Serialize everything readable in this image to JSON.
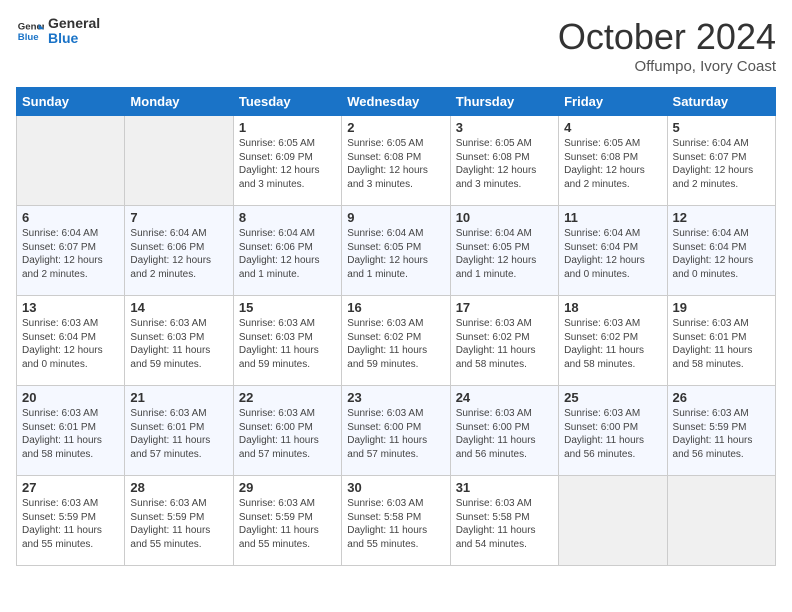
{
  "header": {
    "logo_line1": "General",
    "logo_line2": "Blue",
    "month": "October 2024",
    "location": "Offumpo, Ivory Coast"
  },
  "weekdays": [
    "Sunday",
    "Monday",
    "Tuesday",
    "Wednesday",
    "Thursday",
    "Friday",
    "Saturday"
  ],
  "weeks": [
    [
      {
        "day": "",
        "info": ""
      },
      {
        "day": "",
        "info": ""
      },
      {
        "day": "1",
        "info": "Sunrise: 6:05 AM\nSunset: 6:09 PM\nDaylight: 12 hours and 3 minutes."
      },
      {
        "day": "2",
        "info": "Sunrise: 6:05 AM\nSunset: 6:08 PM\nDaylight: 12 hours and 3 minutes."
      },
      {
        "day": "3",
        "info": "Sunrise: 6:05 AM\nSunset: 6:08 PM\nDaylight: 12 hours and 3 minutes."
      },
      {
        "day": "4",
        "info": "Sunrise: 6:05 AM\nSunset: 6:08 PM\nDaylight: 12 hours and 2 minutes."
      },
      {
        "day": "5",
        "info": "Sunrise: 6:04 AM\nSunset: 6:07 PM\nDaylight: 12 hours and 2 minutes."
      }
    ],
    [
      {
        "day": "6",
        "info": "Sunrise: 6:04 AM\nSunset: 6:07 PM\nDaylight: 12 hours and 2 minutes."
      },
      {
        "day": "7",
        "info": "Sunrise: 6:04 AM\nSunset: 6:06 PM\nDaylight: 12 hours and 2 minutes."
      },
      {
        "day": "8",
        "info": "Sunrise: 6:04 AM\nSunset: 6:06 PM\nDaylight: 12 hours and 1 minute."
      },
      {
        "day": "9",
        "info": "Sunrise: 6:04 AM\nSunset: 6:05 PM\nDaylight: 12 hours and 1 minute."
      },
      {
        "day": "10",
        "info": "Sunrise: 6:04 AM\nSunset: 6:05 PM\nDaylight: 12 hours and 1 minute."
      },
      {
        "day": "11",
        "info": "Sunrise: 6:04 AM\nSunset: 6:04 PM\nDaylight: 12 hours and 0 minutes."
      },
      {
        "day": "12",
        "info": "Sunrise: 6:04 AM\nSunset: 6:04 PM\nDaylight: 12 hours and 0 minutes."
      }
    ],
    [
      {
        "day": "13",
        "info": "Sunrise: 6:03 AM\nSunset: 6:04 PM\nDaylight: 12 hours and 0 minutes."
      },
      {
        "day": "14",
        "info": "Sunrise: 6:03 AM\nSunset: 6:03 PM\nDaylight: 11 hours and 59 minutes."
      },
      {
        "day": "15",
        "info": "Sunrise: 6:03 AM\nSunset: 6:03 PM\nDaylight: 11 hours and 59 minutes."
      },
      {
        "day": "16",
        "info": "Sunrise: 6:03 AM\nSunset: 6:02 PM\nDaylight: 11 hours and 59 minutes."
      },
      {
        "day": "17",
        "info": "Sunrise: 6:03 AM\nSunset: 6:02 PM\nDaylight: 11 hours and 58 minutes."
      },
      {
        "day": "18",
        "info": "Sunrise: 6:03 AM\nSunset: 6:02 PM\nDaylight: 11 hours and 58 minutes."
      },
      {
        "day": "19",
        "info": "Sunrise: 6:03 AM\nSunset: 6:01 PM\nDaylight: 11 hours and 58 minutes."
      }
    ],
    [
      {
        "day": "20",
        "info": "Sunrise: 6:03 AM\nSunset: 6:01 PM\nDaylight: 11 hours and 58 minutes."
      },
      {
        "day": "21",
        "info": "Sunrise: 6:03 AM\nSunset: 6:01 PM\nDaylight: 11 hours and 57 minutes."
      },
      {
        "day": "22",
        "info": "Sunrise: 6:03 AM\nSunset: 6:00 PM\nDaylight: 11 hours and 57 minutes."
      },
      {
        "day": "23",
        "info": "Sunrise: 6:03 AM\nSunset: 6:00 PM\nDaylight: 11 hours and 57 minutes."
      },
      {
        "day": "24",
        "info": "Sunrise: 6:03 AM\nSunset: 6:00 PM\nDaylight: 11 hours and 56 minutes."
      },
      {
        "day": "25",
        "info": "Sunrise: 6:03 AM\nSunset: 6:00 PM\nDaylight: 11 hours and 56 minutes."
      },
      {
        "day": "26",
        "info": "Sunrise: 6:03 AM\nSunset: 5:59 PM\nDaylight: 11 hours and 56 minutes."
      }
    ],
    [
      {
        "day": "27",
        "info": "Sunrise: 6:03 AM\nSunset: 5:59 PM\nDaylight: 11 hours and 55 minutes."
      },
      {
        "day": "28",
        "info": "Sunrise: 6:03 AM\nSunset: 5:59 PM\nDaylight: 11 hours and 55 minutes."
      },
      {
        "day": "29",
        "info": "Sunrise: 6:03 AM\nSunset: 5:59 PM\nDaylight: 11 hours and 55 minutes."
      },
      {
        "day": "30",
        "info": "Sunrise: 6:03 AM\nSunset: 5:58 PM\nDaylight: 11 hours and 55 minutes."
      },
      {
        "day": "31",
        "info": "Sunrise: 6:03 AM\nSunset: 5:58 PM\nDaylight: 11 hours and 54 minutes."
      },
      {
        "day": "",
        "info": ""
      },
      {
        "day": "",
        "info": ""
      }
    ]
  ]
}
